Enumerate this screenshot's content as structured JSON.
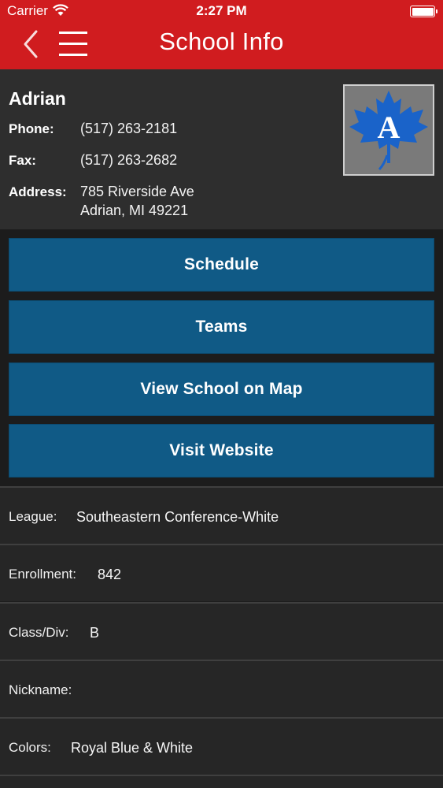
{
  "status_bar": {
    "carrier": "Carrier",
    "time": "2:27 PM"
  },
  "nav": {
    "title": "School Info"
  },
  "school": {
    "name": "Adrian",
    "phone_label": "Phone:",
    "phone": "(517) 263-2181",
    "fax_label": "Fax:",
    "fax": "(517) 263-2682",
    "address_label": "Address:",
    "address_line1": "785 Riverside Ave",
    "address_line2": "Adrian, MI 49221",
    "logo_letter": "A"
  },
  "buttons": {
    "schedule": "Schedule",
    "teams": "Teams",
    "map": "View School on Map",
    "website": "Visit Website"
  },
  "details": [
    {
      "label": "League:",
      "value": "Southeastern Conference-White"
    },
    {
      "label": "Enrollment:",
      "value": "842"
    },
    {
      "label": "Class/Div:",
      "value": "B"
    },
    {
      "label": "Nickname:",
      "value": ""
    },
    {
      "label": "Colors:",
      "value": "Royal Blue & White"
    }
  ],
  "colors": {
    "nav_red": "#d01c1f",
    "button_blue": "#105a86",
    "logo_blue": "#1a63c9",
    "logo_gray": "#7a7a7a"
  }
}
